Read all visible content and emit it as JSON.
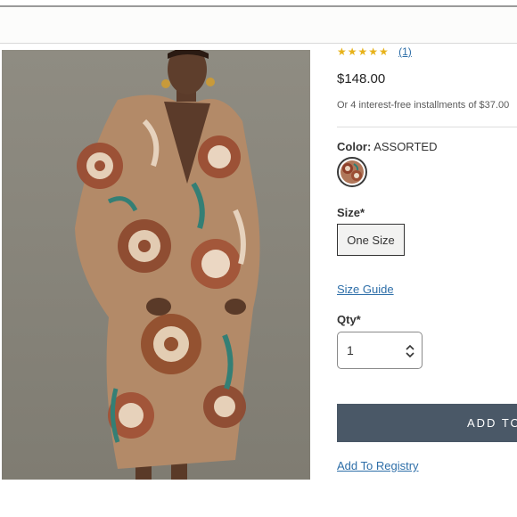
{
  "product": {
    "rating_stars": "★★★★★",
    "review_count": "(1)",
    "price": "$148.00",
    "installments_text": "Or 4 interest-free installments of $37.00"
  },
  "color": {
    "label": "Color:",
    "value": "ASSORTED"
  },
  "size": {
    "label": "Size*",
    "selected": "One Size",
    "guide_link": "Size Guide"
  },
  "quantity": {
    "label": "Qty*",
    "value": "1"
  },
  "actions": {
    "add_to_cart": "ADD TO BAG",
    "add_to_registry": "Add To Registry"
  },
  "icons": {
    "expand": "expand-icon",
    "stepper": "chevron-up-down-icon",
    "rating": "star-icon"
  },
  "colors": {
    "link": "#2d6ea8",
    "button_bg": "#4a5867",
    "star": "#e7b21a",
    "photo_bg": "#8d8a7f"
  }
}
